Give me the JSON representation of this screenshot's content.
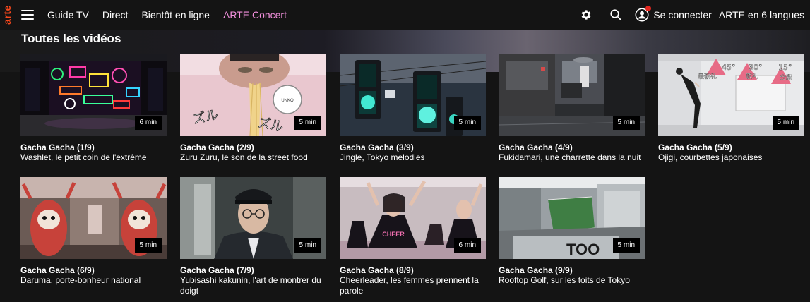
{
  "header": {
    "logo": "arte",
    "nav": [
      "Guide TV",
      "Direct",
      "Bientôt en ligne",
      "ARTE Concert"
    ],
    "login_label": "Se connecter",
    "languages_label": "ARTE en 6 langues"
  },
  "section_title": "Toutes les vidéos",
  "videos": [
    {
      "title": "Gacha Gacha (1/9)",
      "subtitle": "Washlet, le petit coin de l'extrême",
      "duration": "6 min"
    },
    {
      "title": "Gacha Gacha (2/9)",
      "subtitle": "Zuru Zuru, le son de la street food",
      "duration": "5 min"
    },
    {
      "title": "Gacha Gacha (3/9)",
      "subtitle": "Jingle, Tokyo melodies",
      "duration": "5 min"
    },
    {
      "title": "Gacha Gacha (4/9)",
      "subtitle": "Fukidamari, une charrette dans la nuit",
      "duration": "5 min"
    },
    {
      "title": "Gacha Gacha (5/9)",
      "subtitle": "Ojigi, courbettes japonaises",
      "duration": "5 min"
    },
    {
      "title": "Gacha Gacha (6/9)",
      "subtitle": "Daruma, porte-bonheur national",
      "duration": "5 min"
    },
    {
      "title": "Gacha Gacha (7/9)",
      "subtitle": "Yubisashi kakunin, l'art de montrer du doigt",
      "duration": "5 min"
    },
    {
      "title": "Gacha Gacha (8/9)",
      "subtitle": "Cheerleader, les femmes prennent la parole",
      "duration": "6 min"
    },
    {
      "title": "Gacha Gacha (9/9)",
      "subtitle": "Rooftop Golf, sur les toits de Tokyo",
      "duration": "5 min"
    }
  ],
  "thumb_text": {
    "v2_sound": "ズル",
    "v5_angles": [
      "45°",
      "30°",
      "15°"
    ],
    "v5_words": [
      "最敬礼",
      "敬礼",
      "会釈"
    ],
    "v8_shirt": "CHEER",
    "v9_sign": "TOO"
  },
  "colors": {
    "accent_logo": "#fa481c",
    "concert": "#f290dd",
    "notif": "#e3271f"
  }
}
